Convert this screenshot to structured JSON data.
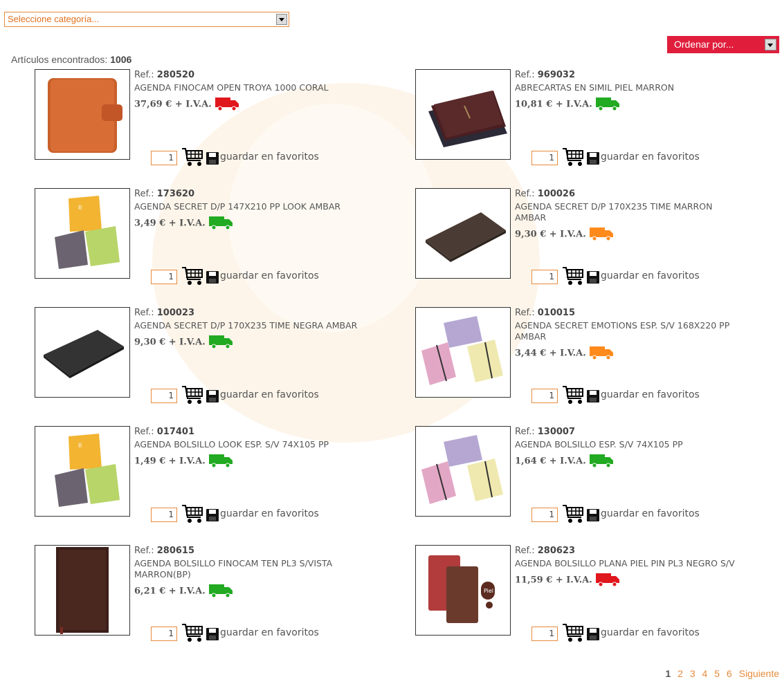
{
  "category_select": {
    "value": "Seleccione categoría..."
  },
  "sort_select": {
    "value": "Ordenar por..."
  },
  "results": {
    "label": "Artículos encontrados:",
    "count": "1006"
  },
  "ref_label": "Ref.:",
  "price_suffix": "+ I.V.A.",
  "favorite_label": "guardar en favoritos",
  "products": [
    {
      "ref": "280520",
      "desc": "AGENDA FINOCAM OPEN TROYA 1000 CORAL",
      "price": "37,69 €",
      "stock": "red",
      "qty": "1",
      "image": "orange-binder"
    },
    {
      "ref": "969032",
      "desc": "ABRECARTAS EN SIMIL PIEL MARRON",
      "price": "10,81 €",
      "stock": "green",
      "qty": "1",
      "image": "leather-folder"
    },
    {
      "ref": "173620",
      "desc": "AGENDA SECRET D/P 147X210 PP LOOK AMBAR",
      "price": "3,49 €",
      "stock": "green",
      "qty": "1",
      "image": "colored-notebooks"
    },
    {
      "ref": "100026",
      "desc": "AGENDA SECRET D/P 170X235 TIME MARRON AMBAR",
      "price": "9,30 €",
      "stock": "orange",
      "qty": "1",
      "image": "brown-notebook"
    },
    {
      "ref": "100023",
      "desc": "AGENDA SECRET D/P 170X235 TIME NEGRA AMBAR",
      "price": "9,30 €",
      "stock": "green",
      "qty": "1",
      "image": "black-notebook"
    },
    {
      "ref": "010015",
      "desc": "AGENDA SECRET EMOTIONS ESP. S/V 168X220 PP AMBAR",
      "price": "3,44 €",
      "stock": "orange",
      "qty": "1",
      "image": "floral-notebooks"
    },
    {
      "ref": "017401",
      "desc": "AGENDA BOLSILLO LOOK ESP. S/V 74X105 PP",
      "price": "1,49 €",
      "stock": "green",
      "qty": "1",
      "image": "colored-notebooks"
    },
    {
      "ref": "130007",
      "desc": "AGENDA BOLSILLO ESP. S/V 74X105 PP",
      "price": "1,64 €",
      "stock": "green",
      "qty": "1",
      "image": "floral-notebooks"
    },
    {
      "ref": "280615",
      "desc": "AGENDA BOLSILLO FINOCAM TEN PL3 S/VISTA MARRON(BP)",
      "price": "6,21 €",
      "stock": "green",
      "qty": "1",
      "image": "tall-brown-diary"
    },
    {
      "ref": "280623",
      "desc": "AGENDA BOLSILLO PLANA PIEL PIN PL3 NEGRO S/V",
      "price": "11,59 €",
      "stock": "red",
      "qty": "1",
      "image": "leather-diaries"
    }
  ],
  "pagination": {
    "pages": [
      "1",
      "2",
      "3",
      "4",
      "5",
      "6"
    ],
    "current": "1",
    "next_label": "Siguiente"
  },
  "colors": {
    "accent": "#e78b3c",
    "sort_bg": "#e01e3c",
    "stock_green": "#22aa22",
    "stock_orange": "#ff8a1c",
    "stock_red": "#e0171d"
  }
}
